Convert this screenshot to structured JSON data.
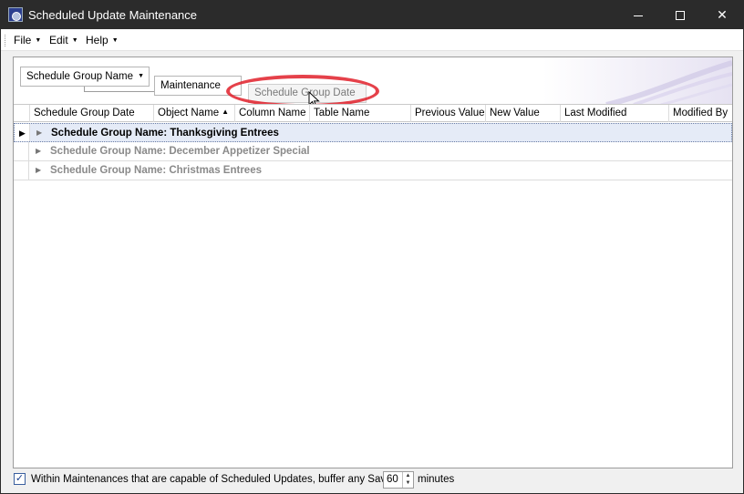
{
  "window": {
    "title": "Scheduled Update Maintenance",
    "controls": {
      "minimize_icon": "minimize-icon",
      "maximize_icon": "maximize-icon",
      "close_glyph": "✕"
    }
  },
  "menu": {
    "items": [
      {
        "label": "File"
      },
      {
        "label": "Edit"
      },
      {
        "label": "Help"
      }
    ]
  },
  "group_panel": {
    "chips": [
      {
        "label": "Schedule Group Name"
      },
      {
        "label": "Maintenance"
      }
    ],
    "dragging_column": "Schedule Group Date",
    "highlight_color": "#e0202a"
  },
  "grid": {
    "columns": [
      {
        "label": "Schedule Group Date"
      },
      {
        "label": "Object Name",
        "sorted": "ascending"
      },
      {
        "label": "Column Name"
      },
      {
        "label": "Table Name"
      },
      {
        "label": "Previous Value"
      },
      {
        "label": "New Value"
      },
      {
        "label": "Last Modified"
      },
      {
        "label": "Modified By"
      }
    ],
    "groups": [
      {
        "label": "Schedule Group Name: Thanksgiving Entrees",
        "selected": true
      },
      {
        "label": "Schedule Group Name: December Appetizer Special",
        "selected": false
      },
      {
        "label": "Schedule Group Name: Christmas Entrees",
        "selected": false
      }
    ]
  },
  "footer": {
    "checkbox_checked": true,
    "label": "Within Maintenances that are capable of Scheduled Updates, buffer any Save by",
    "buffer_value": "60",
    "unit_label": "minutes"
  }
}
